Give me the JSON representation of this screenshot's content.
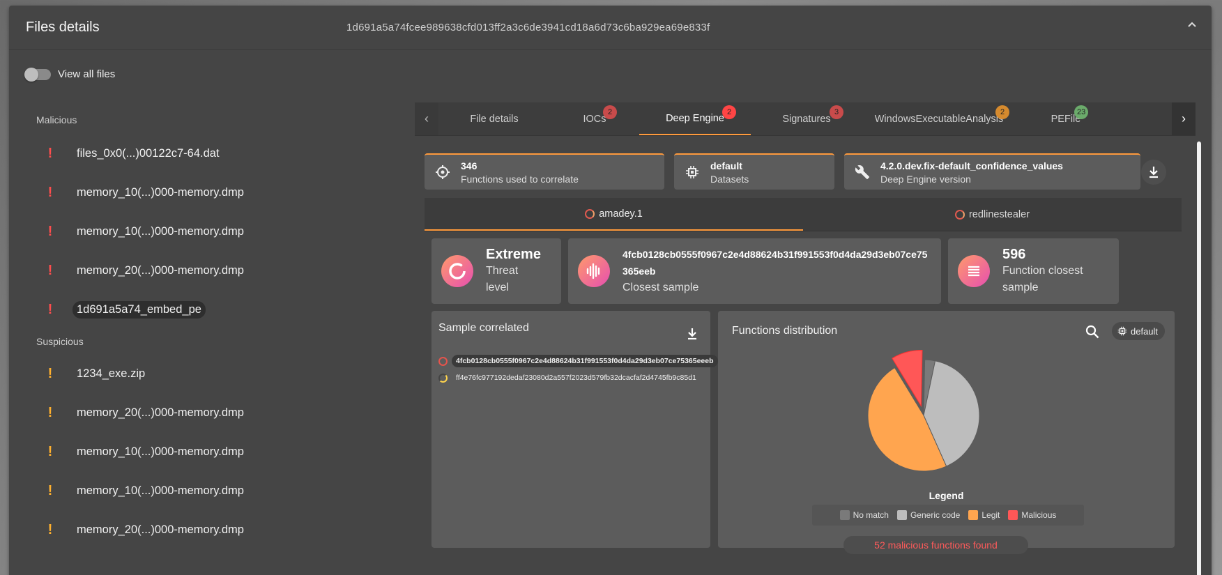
{
  "header": {
    "title": "Files details",
    "hash": "1d691a5a74fcee989638cfd013ff2a3c6de3941cd18a6d73c6ba929ea69e833f"
  },
  "toggle": {
    "label": "View all files",
    "on": false
  },
  "sidebar": {
    "malicious_label": "Malicious",
    "malicious": [
      "files_0x0(...)00122c7-64.dat",
      "memory_10(...)000-memory.dmp",
      "memory_10(...)000-memory.dmp",
      "memory_20(...)000-memory.dmp",
      "1d691a5a74_embed_pe"
    ],
    "suspicious_label": "Suspicious",
    "suspicious": [
      "1234_exe.zip",
      "memory_20(...)000-memory.dmp",
      "memory_10(...)000-memory.dmp",
      "memory_10(...)000-memory.dmp",
      "memory_20(...)000-memory.dmp"
    ]
  },
  "tabs": [
    {
      "label": "File details",
      "badge": "",
      "badge_color": ""
    },
    {
      "label": "IOCs",
      "badge": "2",
      "badge_color": "#c94b4b"
    },
    {
      "label": "Deep Engine",
      "badge": "2",
      "badge_color": "#ff4545"
    },
    {
      "label": "Signatures",
      "badge": "3",
      "badge_color": "#c94b4b"
    },
    {
      "label": "WindowsExecutableAnalysis",
      "badge": "2",
      "badge_color": "#d58a2e"
    },
    {
      "label": "PEFile",
      "badge": "23",
      "badge_color": "#6bab6b"
    }
  ],
  "meta": {
    "functions": {
      "value": "346",
      "label": "Functions used to correlate"
    },
    "datasets": {
      "value": "default",
      "label": "Datasets"
    },
    "version": {
      "value": "4.2.0.dev.fix-default_confidence_values",
      "label": "Deep Engine version"
    }
  },
  "subtabs": [
    "amadey.1",
    "redlinestealer"
  ],
  "summary": {
    "threat": {
      "value": "Extreme",
      "label": "Threat level"
    },
    "closest": {
      "value": "4fcb0128cb0555f0967c2e4d88624b31f991553f0d4da29d3eb07ce75365eeb",
      "label": "Closest sample"
    },
    "fn_closest": {
      "value": "596",
      "label": "Function closest sample"
    }
  },
  "correlated": {
    "title": "Sample correlated",
    "rows": [
      "4fcb0128cb0555f0967c2e4d88624b31f991553f0d4da29d3eb07ce75365eeeb",
      "ff4e76fc977192dedaf23080d2a557f2023d579fb32dcacfaf2d4745fb9c85d1"
    ]
  },
  "distribution": {
    "title": "Functions distribution",
    "chip": "default",
    "legend_title": "Legend",
    "malicious_found": "52 malicious functions found"
  },
  "chart_data": {
    "type": "pie",
    "categories": [
      "No match",
      "Generic code",
      "Legit",
      "Malicious"
    ],
    "values": [
      3,
      40,
      48,
      9
    ],
    "colors": [
      "#7a7a7a",
      "#bdbdbd",
      "#ffa54f",
      "#ff5757"
    ]
  }
}
